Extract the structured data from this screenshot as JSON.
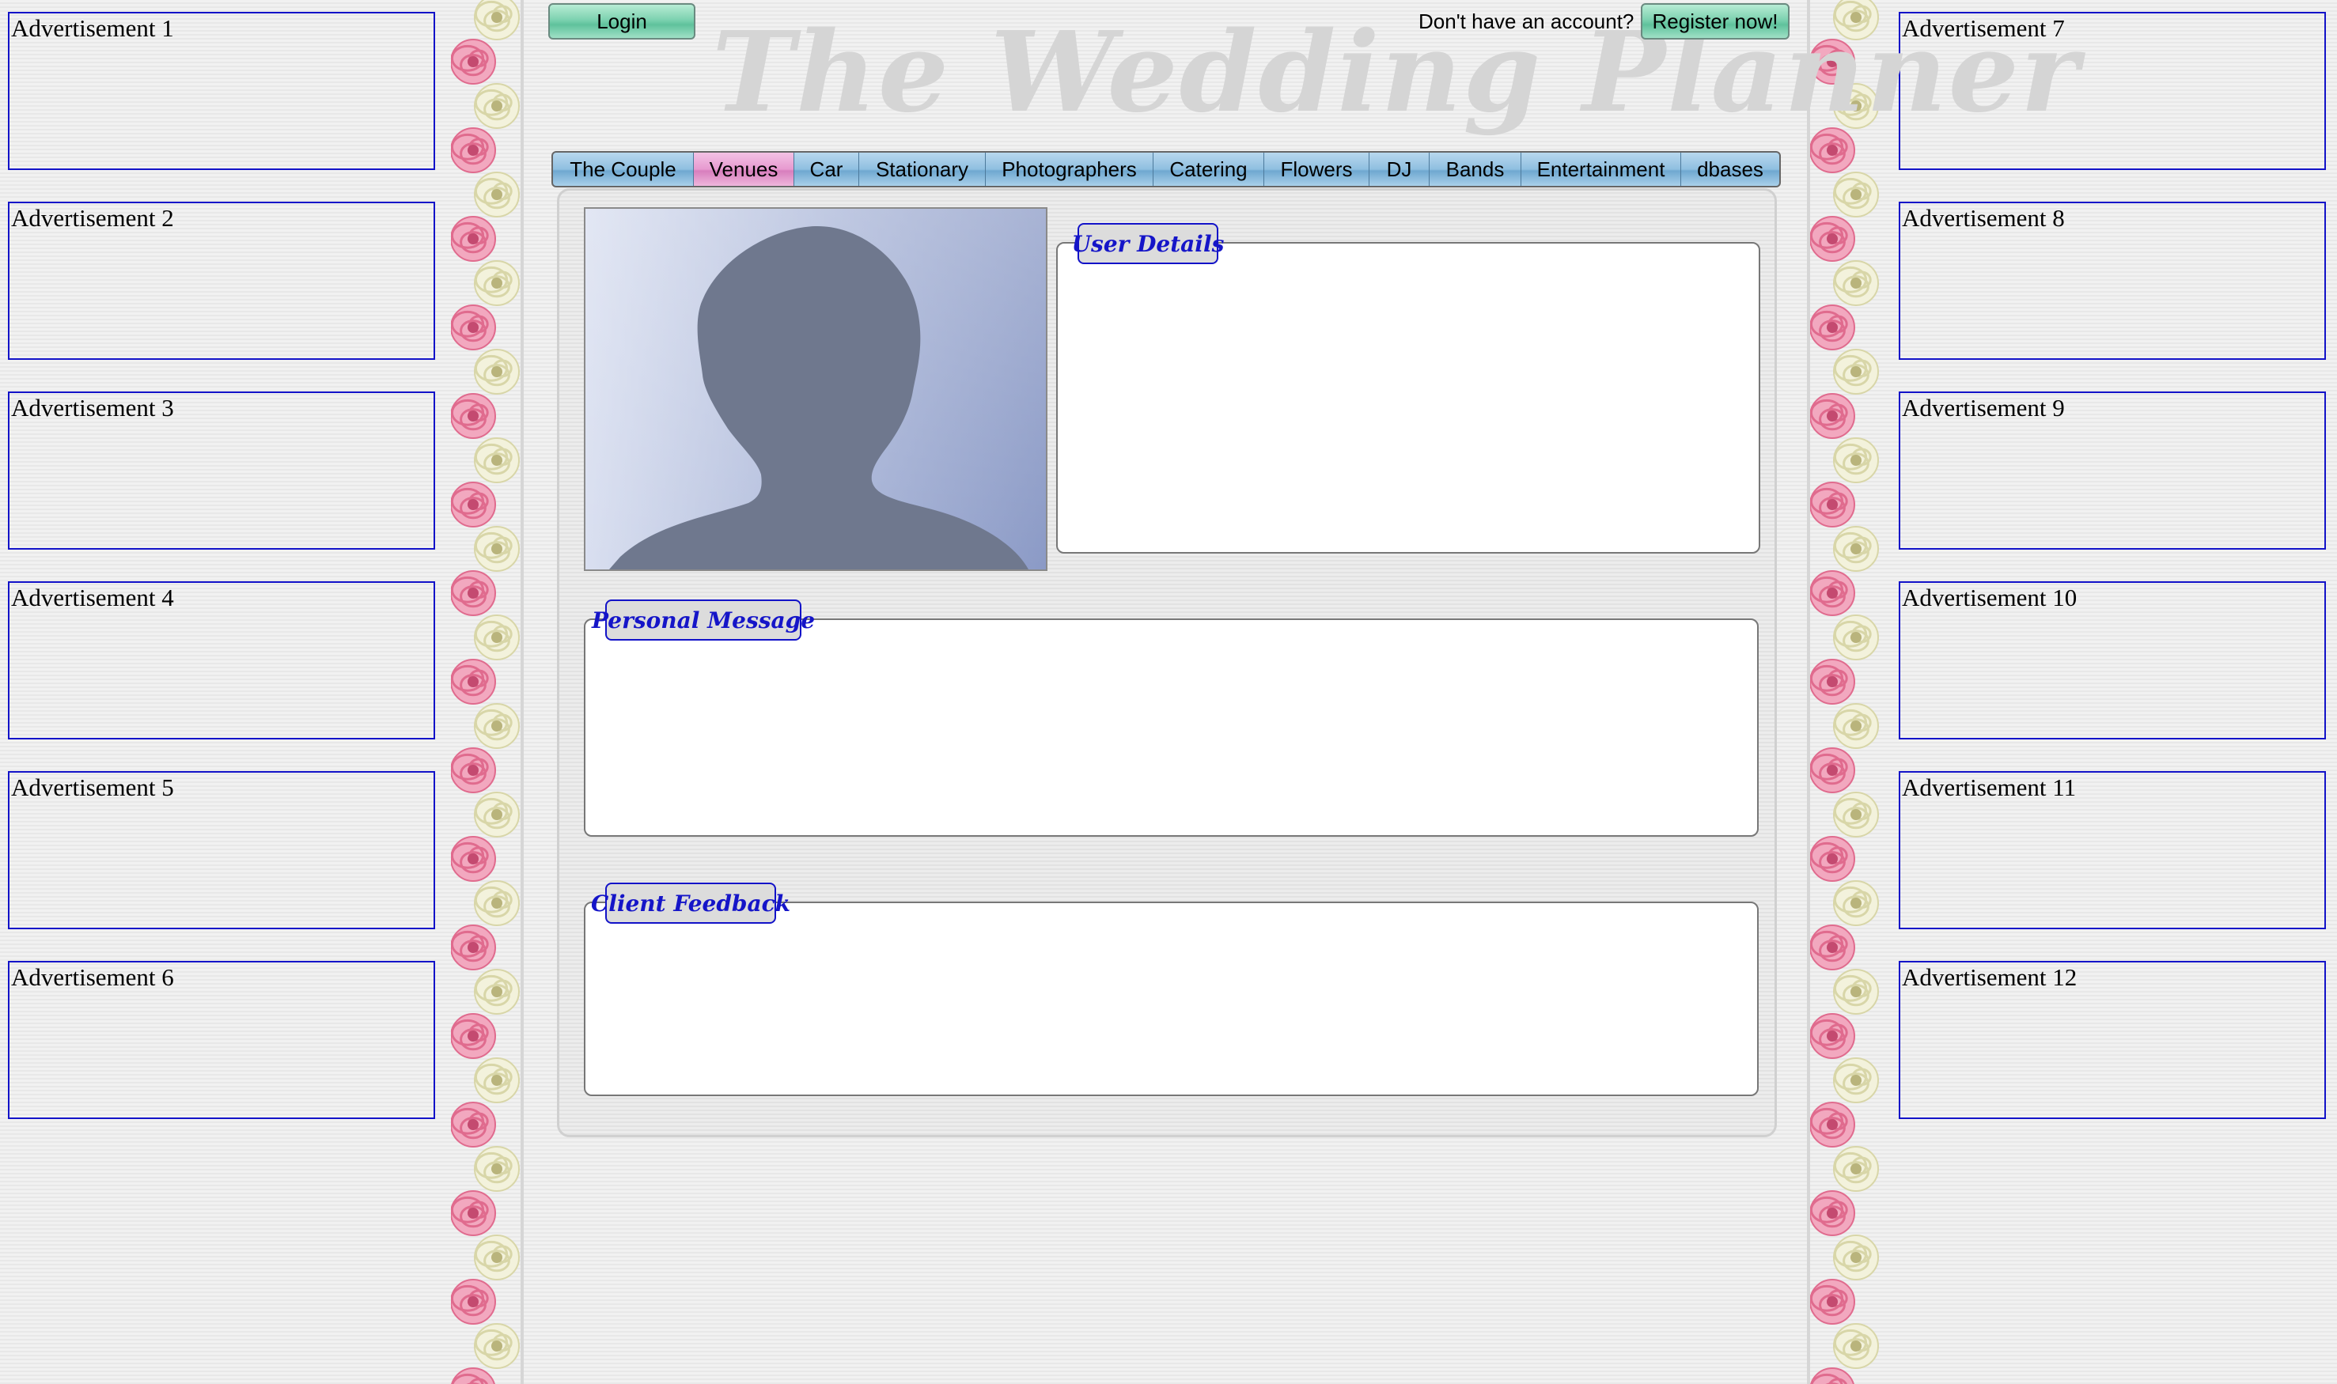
{
  "header": {
    "login_label": "Login",
    "no_account_text": "Don't have an account?",
    "register_label": "Register now!",
    "site_title": "The Wedding Planner"
  },
  "nav": {
    "items": [
      {
        "label": "The Couple",
        "active": false
      },
      {
        "label": "Venues",
        "active": true
      },
      {
        "label": "Car",
        "active": false
      },
      {
        "label": "Stationary",
        "active": false
      },
      {
        "label": "Photographers",
        "active": false
      },
      {
        "label": "Catering",
        "active": false
      },
      {
        "label": "Flowers",
        "active": false
      },
      {
        "label": "DJ",
        "active": false
      },
      {
        "label": "Bands",
        "active": false
      },
      {
        "label": "Entertainment",
        "active": false
      },
      {
        "label": "dbases",
        "active": false
      }
    ]
  },
  "ads": {
    "left": [
      "Advertisement 1",
      "Advertisement 2",
      "Advertisement 3",
      "Advertisement 4",
      "Advertisement 5",
      "Advertisement 6"
    ],
    "right": [
      "Advertisement 7",
      "Advertisement 8",
      "Advertisement 9",
      "Advertisement 10",
      "Advertisement 11",
      "Advertisement 12"
    ]
  },
  "profile": {
    "avatar_icon": "person-silhouette-icon",
    "user_details_legend": "User Details",
    "personal_message_legend": "Personal Message",
    "client_feedback_legend": "Client Feedback"
  },
  "colors": {
    "ad_border": "#1212c8",
    "legend_text": "#1515c8",
    "active_tab": "#e79ad0",
    "tab": "#8fbfe0",
    "button_green": "#7dd2b0"
  }
}
